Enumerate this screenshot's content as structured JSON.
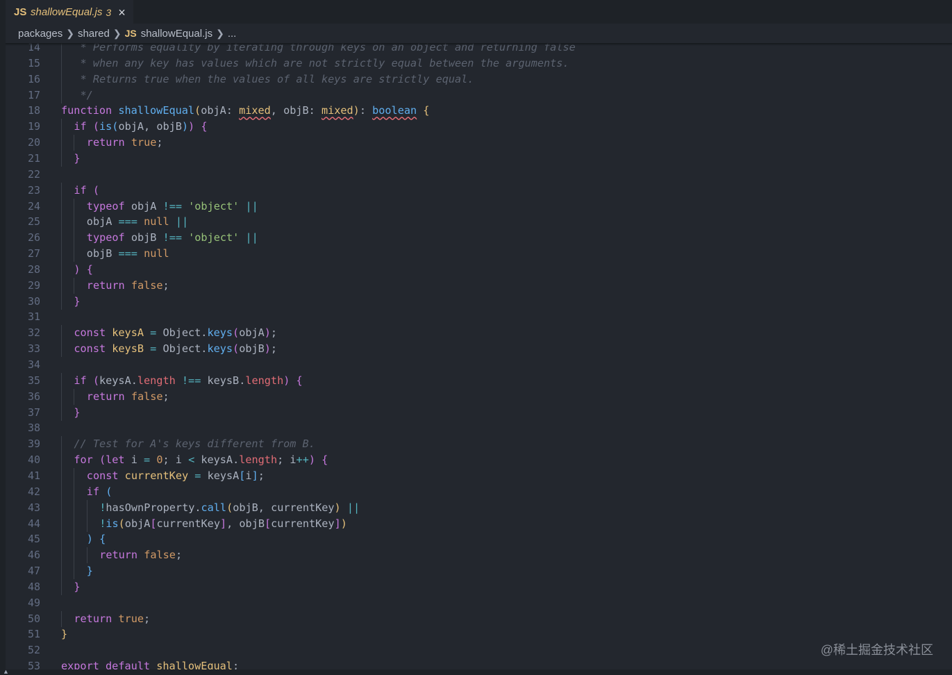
{
  "tab": {
    "language_badge": "JS",
    "filename": "shallowEqual.js",
    "problem_count": "3",
    "close_icon": "×"
  },
  "breadcrumb": {
    "segments": [
      "packages",
      "shared"
    ],
    "file_badge": "JS",
    "file": "shallowEqual.js",
    "trailing": "..."
  },
  "watermark": "@稀土掘金技术社区",
  "editor": {
    "lines": [
      {
        "n": "14",
        "g": 1,
        "t": [
          [
            "cm",
            " * Performs equality by iterating through keys on an object and returning false"
          ]
        ]
      },
      {
        "n": "15",
        "g": 1,
        "t": [
          [
            "cm",
            " * when any key has values which are not strictly equal between the arguments."
          ]
        ]
      },
      {
        "n": "16",
        "g": 1,
        "t": [
          [
            "cm",
            " * Returns true when the values of all keys are strictly equal."
          ]
        ]
      },
      {
        "n": "17",
        "g": 1,
        "t": [
          [
            "cm",
            " */"
          ]
        ]
      },
      {
        "n": "18",
        "g": 0,
        "t": [
          [
            "kw",
            "function"
          ],
          [
            "tx",
            " "
          ],
          [
            "fn",
            "shallowEqual"
          ],
          [
            "p1",
            "("
          ],
          [
            "tx",
            "objA: "
          ],
          [
            "typ sq",
            "mixed"
          ],
          [
            "tx",
            ", objB: "
          ],
          [
            "typ sq",
            "mixed"
          ],
          [
            "p1",
            ")"
          ],
          [
            "tx",
            ": "
          ],
          [
            "fn sq",
            "boolean"
          ],
          [
            "tx",
            " "
          ],
          [
            "p1",
            "{"
          ]
        ]
      },
      {
        "n": "19",
        "g": 1,
        "t": [
          [
            "kw",
            "if"
          ],
          [
            "tx",
            " "
          ],
          [
            "p2",
            "("
          ],
          [
            "fn",
            "is"
          ],
          [
            "p3",
            "("
          ],
          [
            "tx",
            "objA, objB"
          ],
          [
            "p3",
            ")"
          ],
          [
            "p2",
            ")"
          ],
          [
            "tx",
            " "
          ],
          [
            "p2",
            "{"
          ]
        ]
      },
      {
        "n": "20",
        "g": 2,
        "t": [
          [
            "kw",
            "return"
          ],
          [
            "tx",
            " "
          ],
          [
            "num",
            "true"
          ],
          [
            "tx",
            ";"
          ]
        ]
      },
      {
        "n": "21",
        "g": 1,
        "t": [
          [
            "p2",
            "}"
          ]
        ]
      },
      {
        "n": "22",
        "g": 0,
        "t": []
      },
      {
        "n": "23",
        "g": 1,
        "t": [
          [
            "kw",
            "if"
          ],
          [
            "tx",
            " "
          ],
          [
            "p2",
            "("
          ]
        ]
      },
      {
        "n": "24",
        "g": 2,
        "t": [
          [
            "kw",
            "typeof"
          ],
          [
            "tx",
            " objA "
          ],
          [
            "op",
            "!=="
          ],
          [
            "tx",
            " "
          ],
          [
            "str",
            "'object'"
          ],
          [
            "tx",
            " "
          ],
          [
            "op",
            "||"
          ]
        ]
      },
      {
        "n": "25",
        "g": 2,
        "t": [
          [
            "tx",
            "objA "
          ],
          [
            "op",
            "==="
          ],
          [
            "tx",
            " "
          ],
          [
            "num",
            "null"
          ],
          [
            "tx",
            " "
          ],
          [
            "op",
            "||"
          ]
        ]
      },
      {
        "n": "26",
        "g": 2,
        "t": [
          [
            "kw",
            "typeof"
          ],
          [
            "tx",
            " objB "
          ],
          [
            "op",
            "!=="
          ],
          [
            "tx",
            " "
          ],
          [
            "str",
            "'object'"
          ],
          [
            "tx",
            " "
          ],
          [
            "op",
            "||"
          ]
        ]
      },
      {
        "n": "27",
        "g": 2,
        "t": [
          [
            "tx",
            "objB "
          ],
          [
            "op",
            "==="
          ],
          [
            "tx",
            " "
          ],
          [
            "num",
            "null"
          ]
        ]
      },
      {
        "n": "28",
        "g": 1,
        "t": [
          [
            "p2",
            ")"
          ],
          [
            "tx",
            " "
          ],
          [
            "p2",
            "{"
          ]
        ]
      },
      {
        "n": "29",
        "g": 2,
        "t": [
          [
            "kw",
            "return"
          ],
          [
            "tx",
            " "
          ],
          [
            "num",
            "false"
          ],
          [
            "tx",
            ";"
          ]
        ]
      },
      {
        "n": "30",
        "g": 1,
        "t": [
          [
            "p2",
            "}"
          ]
        ]
      },
      {
        "n": "31",
        "g": 0,
        "t": []
      },
      {
        "n": "32",
        "g": 1,
        "t": [
          [
            "kw",
            "const"
          ],
          [
            "tx",
            " "
          ],
          [
            "typ",
            "keysA"
          ],
          [
            "tx",
            " "
          ],
          [
            "op",
            "="
          ],
          [
            "tx",
            " Object."
          ],
          [
            "fn",
            "keys"
          ],
          [
            "p2",
            "("
          ],
          [
            "tx",
            "objA"
          ],
          [
            "p2",
            ")"
          ],
          [
            "tx",
            ";"
          ]
        ]
      },
      {
        "n": "33",
        "g": 1,
        "t": [
          [
            "kw",
            "const"
          ],
          [
            "tx",
            " "
          ],
          [
            "typ",
            "keysB"
          ],
          [
            "tx",
            " "
          ],
          [
            "op",
            "="
          ],
          [
            "tx",
            " Object."
          ],
          [
            "fn",
            "keys"
          ],
          [
            "p2",
            "("
          ],
          [
            "tx",
            "objB"
          ],
          [
            "p2",
            ")"
          ],
          [
            "tx",
            ";"
          ]
        ]
      },
      {
        "n": "34",
        "g": 0,
        "t": []
      },
      {
        "n": "35",
        "g": 1,
        "t": [
          [
            "kw",
            "if"
          ],
          [
            "tx",
            " "
          ],
          [
            "p2",
            "("
          ],
          [
            "tx",
            "keysA."
          ],
          [
            "var",
            "length"
          ],
          [
            "tx",
            " "
          ],
          [
            "op",
            "!=="
          ],
          [
            "tx",
            " keysB."
          ],
          [
            "var",
            "length"
          ],
          [
            "p2",
            ")"
          ],
          [
            "tx",
            " "
          ],
          [
            "p2",
            "{"
          ]
        ]
      },
      {
        "n": "36",
        "g": 2,
        "t": [
          [
            "kw",
            "return"
          ],
          [
            "tx",
            " "
          ],
          [
            "num",
            "false"
          ],
          [
            "tx",
            ";"
          ]
        ]
      },
      {
        "n": "37",
        "g": 1,
        "t": [
          [
            "p2",
            "}"
          ]
        ]
      },
      {
        "n": "38",
        "g": 0,
        "t": []
      },
      {
        "n": "39",
        "g": 1,
        "t": [
          [
            "cm",
            "// Test for A's keys different from B."
          ]
        ]
      },
      {
        "n": "40",
        "g": 1,
        "t": [
          [
            "kw",
            "for"
          ],
          [
            "tx",
            " "
          ],
          [
            "p2",
            "("
          ],
          [
            "kw",
            "let"
          ],
          [
            "tx",
            " i "
          ],
          [
            "op",
            "="
          ],
          [
            "tx",
            " "
          ],
          [
            "num",
            "0"
          ],
          [
            "tx",
            "; i "
          ],
          [
            "op",
            "<"
          ],
          [
            "tx",
            " keysA."
          ],
          [
            "var",
            "length"
          ],
          [
            "tx",
            "; i"
          ],
          [
            "op",
            "++"
          ],
          [
            "p2",
            ")"
          ],
          [
            "tx",
            " "
          ],
          [
            "p2",
            "{"
          ]
        ]
      },
      {
        "n": "41",
        "g": 2,
        "t": [
          [
            "kw",
            "const"
          ],
          [
            "tx",
            " "
          ],
          [
            "typ",
            "currentKey"
          ],
          [
            "tx",
            " "
          ],
          [
            "op",
            "="
          ],
          [
            "tx",
            " keysA"
          ],
          [
            "p3",
            "["
          ],
          [
            "tx",
            "i"
          ],
          [
            "p3",
            "]"
          ],
          [
            "tx",
            ";"
          ]
        ]
      },
      {
        "n": "42",
        "g": 2,
        "t": [
          [
            "kw",
            "if"
          ],
          [
            "tx",
            " "
          ],
          [
            "p3",
            "("
          ]
        ]
      },
      {
        "n": "43",
        "g": 3,
        "t": [
          [
            "op",
            "!"
          ],
          [
            "tx",
            "hasOwnProperty."
          ],
          [
            "fn",
            "call"
          ],
          [
            "p1",
            "("
          ],
          [
            "tx",
            "objB, currentKey"
          ],
          [
            "p1",
            ")"
          ],
          [
            "tx",
            " "
          ],
          [
            "op",
            "||"
          ]
        ]
      },
      {
        "n": "44",
        "g": 3,
        "t": [
          [
            "op",
            "!"
          ],
          [
            "fn",
            "is"
          ],
          [
            "p1",
            "("
          ],
          [
            "tx",
            "objA"
          ],
          [
            "p2",
            "["
          ],
          [
            "tx",
            "currentKey"
          ],
          [
            "p2",
            "]"
          ],
          [
            "tx",
            ", objB"
          ],
          [
            "p2",
            "["
          ],
          [
            "tx",
            "currentKey"
          ],
          [
            "p2",
            "]"
          ],
          [
            "p1",
            ")"
          ]
        ]
      },
      {
        "n": "45",
        "g": 2,
        "t": [
          [
            "p3",
            ")"
          ],
          [
            "tx",
            " "
          ],
          [
            "p3",
            "{"
          ]
        ]
      },
      {
        "n": "46",
        "g": 3,
        "t": [
          [
            "kw",
            "return"
          ],
          [
            "tx",
            " "
          ],
          [
            "num",
            "false"
          ],
          [
            "tx",
            ";"
          ]
        ]
      },
      {
        "n": "47",
        "g": 2,
        "t": [
          [
            "p3",
            "}"
          ]
        ]
      },
      {
        "n": "48",
        "g": 1,
        "t": [
          [
            "p2",
            "}"
          ]
        ]
      },
      {
        "n": "49",
        "g": 0,
        "t": []
      },
      {
        "n": "50",
        "g": 1,
        "t": [
          [
            "kw",
            "return"
          ],
          [
            "tx",
            " "
          ],
          [
            "num",
            "true"
          ],
          [
            "tx",
            ";"
          ]
        ]
      },
      {
        "n": "51",
        "g": 0,
        "t": [
          [
            "p1",
            "}"
          ]
        ]
      },
      {
        "n": "52",
        "g": 0,
        "t": []
      },
      {
        "n": "53",
        "g": 0,
        "t": [
          [
            "kw",
            "export"
          ],
          [
            "tx",
            " "
          ],
          [
            "kw",
            "default"
          ],
          [
            "tx",
            " "
          ],
          [
            "typ",
            "shallowEqual"
          ],
          [
            "tx",
            ";"
          ]
        ]
      }
    ]
  }
}
